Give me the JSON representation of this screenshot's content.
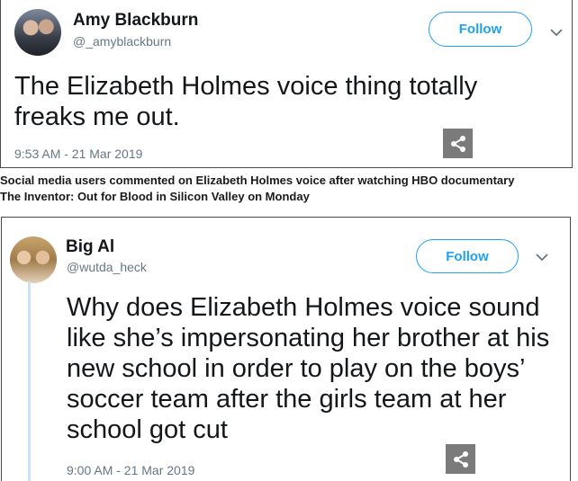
{
  "tweet1": {
    "name": "Amy Blackburn",
    "handle": "@_amyblackburn",
    "follow_label": "Follow",
    "text": "The Elizabeth Holmes voice thing totally freaks me out.",
    "timestamp": "9:53 AM - 21 Mar 2019"
  },
  "caption": {
    "line1": "Social media users commented on Elizabeth Holmes voice after watching HBO documentary",
    "line2": "The Inventor: Out for Blood in Silicon Valley on Monday"
  },
  "tweet2": {
    "name": "Big Al",
    "handle": "@wutda_heck",
    "follow_label": "Follow",
    "text": "Why does Elizabeth Holmes voice sound like she’s impersonating her brother at his new school in order to play on the boys’ soccer team after the girls team at her school got cut",
    "timestamp": "9:00 AM - 21 Mar 2019"
  },
  "icons": {
    "share": "share-icon",
    "chevron": "chevron-down-icon"
  },
  "colors": {
    "accent": "#1da1f2",
    "secondary_text": "#657786",
    "share_bg": "#7b7b7b"
  }
}
